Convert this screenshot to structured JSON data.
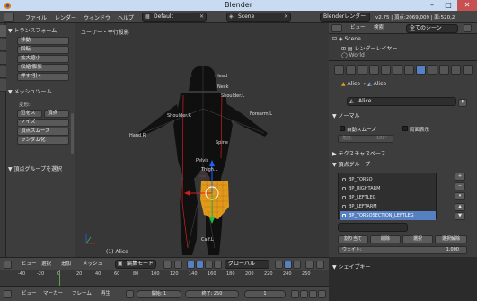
{
  "title_bar": {
    "title": "Blender"
  },
  "top_menu": {
    "items": [
      "ファイル",
      "レンダー",
      "ウィンドウ",
      "ヘルプ"
    ],
    "screen_layout": "Default",
    "scene": "Scene",
    "render_engine": "Blenderレンダー",
    "version_stats": "v2.75 | 頂点:2069,009 | 面:520,2"
  },
  "toolshelf": {
    "transform_header": "トランスフォーム",
    "transform_buttons": [
      "移動",
      "回転",
      "拡大縮小",
      "収縮/膨張",
      "押す/引く"
    ],
    "mesh_tools_header": "メッシュツール",
    "deform_label": "変形:",
    "slide_buttons": [
      "辺をス",
      "頂点"
    ],
    "deform_buttons": [
      "ノイズ",
      "頂点スムーズ",
      "ランダム化"
    ],
    "vertex_group_header": "頂点グループを選択"
  },
  "viewport": {
    "view_label": "ユーザー・平行投影",
    "object_label": "(1) Alice",
    "bone_labels": [
      "Head",
      "Neck",
      "Shoulder.L",
      "Shoulder.R",
      "Hand.R",
      "Forearm.L",
      "Spine",
      "Pelvis",
      "Thigh.L",
      "Calf.L"
    ]
  },
  "outliner": {
    "view_label": "ビュー",
    "search_label": "検索",
    "filter": "全てのシーン",
    "rows": [
      "Scene",
      "レンダーレイヤー",
      "World"
    ]
  },
  "properties": {
    "breadcrumb_obj": "Alice",
    "breadcrumb_data": "Alice",
    "mesh_name": "Alice",
    "fake_user": "F",
    "normals_header": "ノーマル",
    "auto_smooth": "自動スムーズ",
    "double_sided": "両面表示",
    "angle_label": "角度:",
    "angle_value": "180°",
    "texture_space_header": "テクスチャスペース",
    "vertex_groups_header": "頂点グループ",
    "vertex_groups": [
      "BP_TORSO",
      "BP_RIGHTARM",
      "BP_LEFTLEG",
      "BP_LEFTARM",
      "BP_TORSOSECTION_LEFTLEG"
    ],
    "selected_group_index": 4,
    "assign_label": "割り当て",
    "remove_label": "削除",
    "select_label": "選択",
    "deselect_label": "選択解除",
    "weight_label": "ウェイト:",
    "weight_value": "1.000",
    "shape_keys_header": "シェイプキー"
  },
  "viewport_header": {
    "view": "ビュー",
    "select": "選択",
    "add": "追加",
    "mesh": "メッシュ",
    "mode": "編集モード",
    "orientation": "グローバル"
  },
  "timeline": {
    "ticks": [
      "-40",
      "-20",
      "0",
      "20",
      "40",
      "60",
      "80",
      "100",
      "120",
      "140",
      "160",
      "180",
      "200",
      "220",
      "240",
      "260"
    ],
    "view": "ビュー",
    "marker": "マーカー",
    "frame": "フレーム",
    "playback": "再生",
    "start_label": "開始:",
    "start_value": "1",
    "end_label": "終了:",
    "end_value": "250",
    "current_frame": "1"
  },
  "colors": {
    "accent": "#5680c2",
    "selection_orange": "#f0a020",
    "axis_red": "#d02020",
    "axis_green": "#20c040",
    "axis_blue": "#2060ff"
  }
}
